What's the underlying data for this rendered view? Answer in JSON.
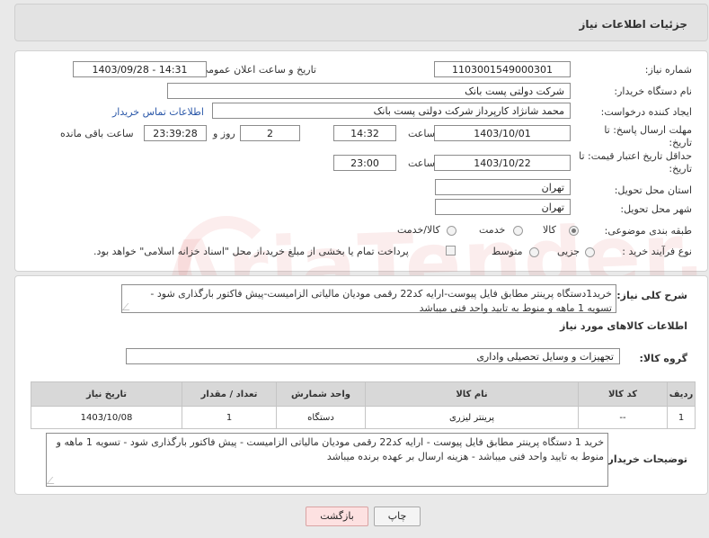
{
  "header": {
    "title": "جزئیات اطلاعات نیاز"
  },
  "form": {
    "need_number": {
      "label": "شماره نیاز:",
      "value": "1103001549000301"
    },
    "announce": {
      "label": "تاریخ و ساعت اعلان عمومی:",
      "value": "1403/09/28 - 14:31"
    },
    "buyer_org": {
      "label": "نام دستگاه خریدار:",
      "value": "شرکت دولتی پست بانک"
    },
    "creator": {
      "label": "ایجاد کننده درخواست:",
      "value": "محمد شانژاد کارپرداز شرکت دولتی پست بانک",
      "contact_link": "اطلاعات تماس خریدار"
    },
    "reply_deadline": {
      "label_line1": "مهلت ارسال پاسخ: تا",
      "label_line2": "تاریخ:",
      "date": "1403/10/01",
      "time_label": "ساعت",
      "time": "14:32",
      "days": "2",
      "days_label": "روز و",
      "remaining": "23:39:28",
      "remaining_label": "ساعت باقی مانده"
    },
    "price_validity": {
      "label_line1": "حداقل تاریخ اعتبار قیمت: تا",
      "label_line2": "تاریخ:",
      "date": "1403/10/22",
      "time_label": "ساعت",
      "time": "23:00"
    },
    "province": {
      "label": "استان محل تحویل:",
      "value": "تهران"
    },
    "city": {
      "label": "شهر محل تحویل:",
      "value": "تهران"
    },
    "category": {
      "label": "طبقه بندی موضوعی:",
      "options": [
        "کالا",
        "خدمت",
        "کالا/خدمت"
      ],
      "selected": "کالا"
    },
    "process_type": {
      "label": "نوع فرآیند خرید :",
      "options": [
        "جزیی",
        "متوسط"
      ],
      "payment_note": "پرداخت تمام یا بخشی از مبلغ خرید،از محل \"اسناد خزانه اسلامی\" خواهد بود."
    }
  },
  "summary": {
    "label": "شرح کلی نیاز:",
    "text": "خرید1دستگاه پرینتر مطابق فایل پیوست-ارایه کد22 رقمی مودیان مالیاتی الزامیست-پیش فاکتور بارگذاری شود - تسویه 1 ماهه و منوط به تایید واحد فنی میباشد"
  },
  "goods": {
    "section_title": "اطلاعات کالاهای مورد نیاز",
    "group_label": "گروه کالا:",
    "group_value": "تجهیزات و وسایل تحصیلی واداری",
    "table": {
      "headers": [
        "ردیف",
        "کد کالا",
        "نام کالا",
        "واحد شمارش",
        "تعداد / مقدار",
        "تاریخ نیاز"
      ],
      "rows": [
        [
          "1",
          "--",
          "پرینتر لیزری",
          "دستگاه",
          "1",
          "1403/10/08"
        ]
      ]
    }
  },
  "buyer_notes": {
    "label": "توضیحات خریدار:",
    "text": "خرید 1 دستگاه پرینتر مطابق فایل پیوست - ارایه کد22 رقمی مودیان مالیاتی الزامیست - پیش فاکتور بارگذاری شود - تسویه 1 ماهه و منوط به تایید واحد فنی میباشد - هزینه ارسال بر عهده برنده میباشد"
  },
  "buttons": {
    "print": "چاپ",
    "back": "بازگشت"
  },
  "watermark": "AriaTender.neT"
}
